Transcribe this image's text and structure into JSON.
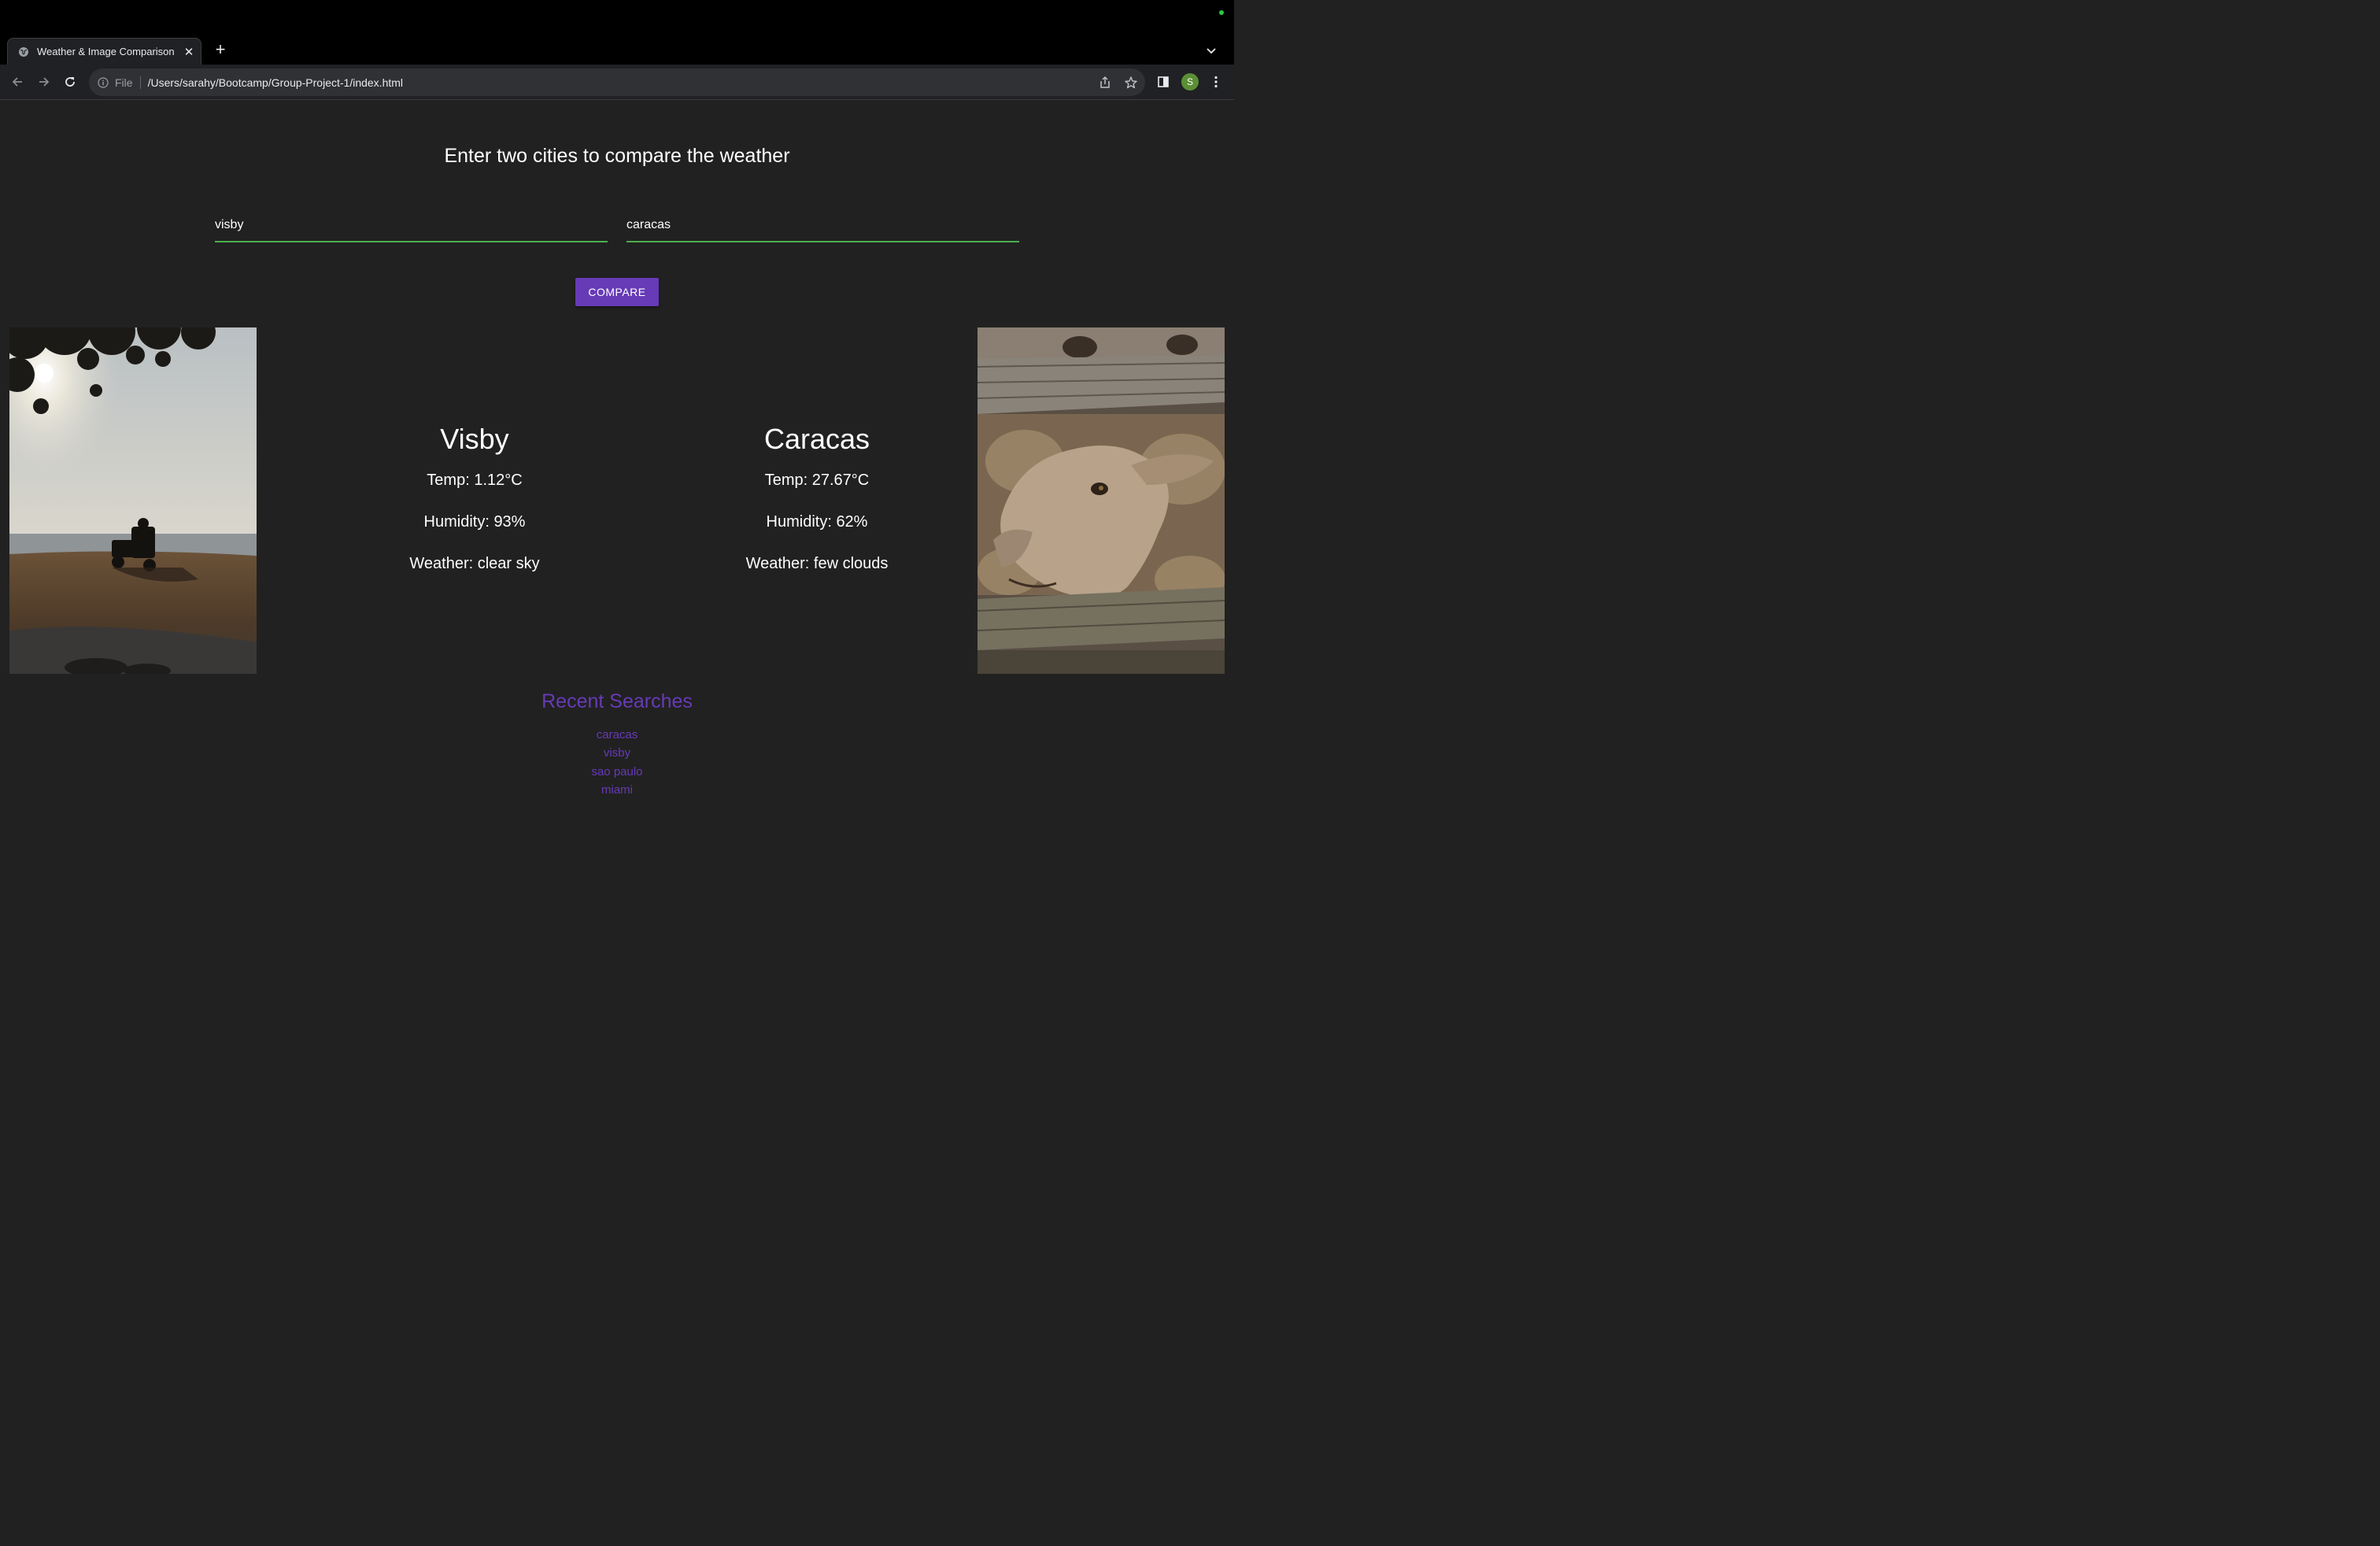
{
  "browser": {
    "tab_title": "Weather & Image Comparison",
    "new_tab_label": "+",
    "tab_close_label": "✕",
    "address_scheme": "File",
    "address_url": "/Users/sarahy/Bootcamp/Group-Project-1/index.html",
    "profile_initial": "S",
    "icons": [
      "globe-icon",
      "close-icon",
      "plus-icon",
      "chevron-down-icon",
      "back-icon",
      "forward-icon",
      "reload-icon",
      "info-icon",
      "share-icon",
      "star-icon",
      "side-panel-icon",
      "kebab-menu-icon"
    ]
  },
  "page": {
    "title": "Enter two cities to compare the weather",
    "city1_value": "visby",
    "city2_value": "caracas",
    "compare_label": "COMPARE",
    "accent_color": "#673ab7",
    "input_underline_color": "#4caf50",
    "background_color": "#212121"
  },
  "city1": {
    "name": "Visby",
    "temp": "Temp: 1.12°C",
    "humidity": "Humidity: 93%",
    "weather": "Weather: clear sky"
  },
  "city2": {
    "name": "Caracas",
    "temp": "Temp: 27.67°C",
    "humidity": "Humidity: 62%",
    "weather": "Weather: few clouds"
  },
  "recent": {
    "title": "Recent Searches",
    "items": [
      "caracas",
      "visby",
      "sao paulo",
      "miami"
    ]
  }
}
